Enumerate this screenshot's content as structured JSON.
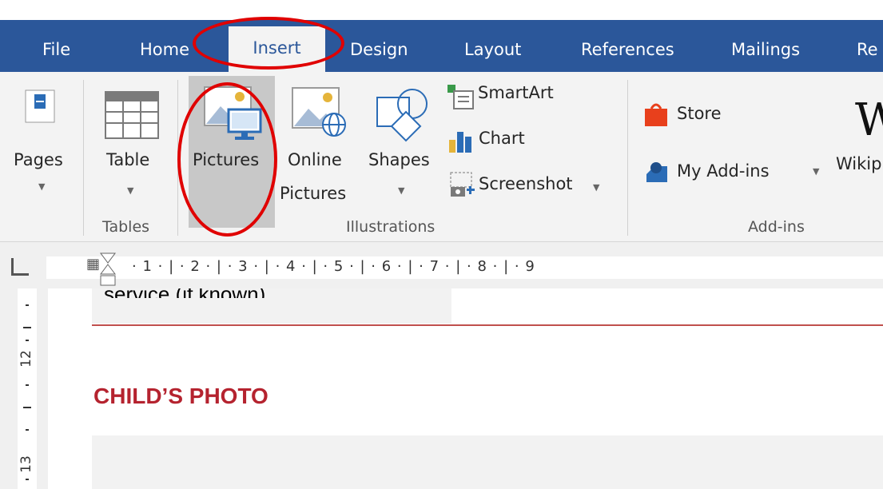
{
  "tabs": {
    "file": "File",
    "home": "Home",
    "insert": "Insert",
    "design": "Design",
    "layout": "Layout",
    "references": "References",
    "mailings": "Mailings",
    "review_partial": "Re"
  },
  "ribbon": {
    "pages_label": "Pages",
    "table_label": "Table",
    "pictures_label": "Pictures",
    "online_pictures_line1": "Online",
    "online_pictures_line2": "Pictures",
    "shapes_label": "Shapes",
    "smartart_label": "SmartArt",
    "chart_label": "Chart",
    "screenshot_label": "Screenshot",
    "store_label": "Store",
    "my_addins_label": "My Add-ins",
    "wikipedia_partial": "Wikip",
    "groups": {
      "tables": "Tables",
      "illustrations": "Illustrations",
      "addins": "Add-ins"
    }
  },
  "ruler": {
    "numbers": [
      "1",
      "2",
      "3",
      "4",
      "5",
      "6",
      "7",
      "8",
      "9"
    ],
    "vertical_numbers": [
      "12",
      "13"
    ]
  },
  "document": {
    "previous_text": "service (if known).",
    "section_title": "CHILD’S PHOTO"
  },
  "colors": {
    "tab_bar": "#2b579a",
    "ribbon_bg": "#f3f3f3",
    "heading": "#b5232f",
    "annotation": "#e00000"
  },
  "icons": [
    "pages-icon",
    "table-icon",
    "pictures-icon",
    "online-pictures-icon",
    "shapes-icon",
    "smartart-icon",
    "chart-icon",
    "screenshot-icon",
    "store-icon",
    "my-addins-icon",
    "wikipedia-icon"
  ]
}
